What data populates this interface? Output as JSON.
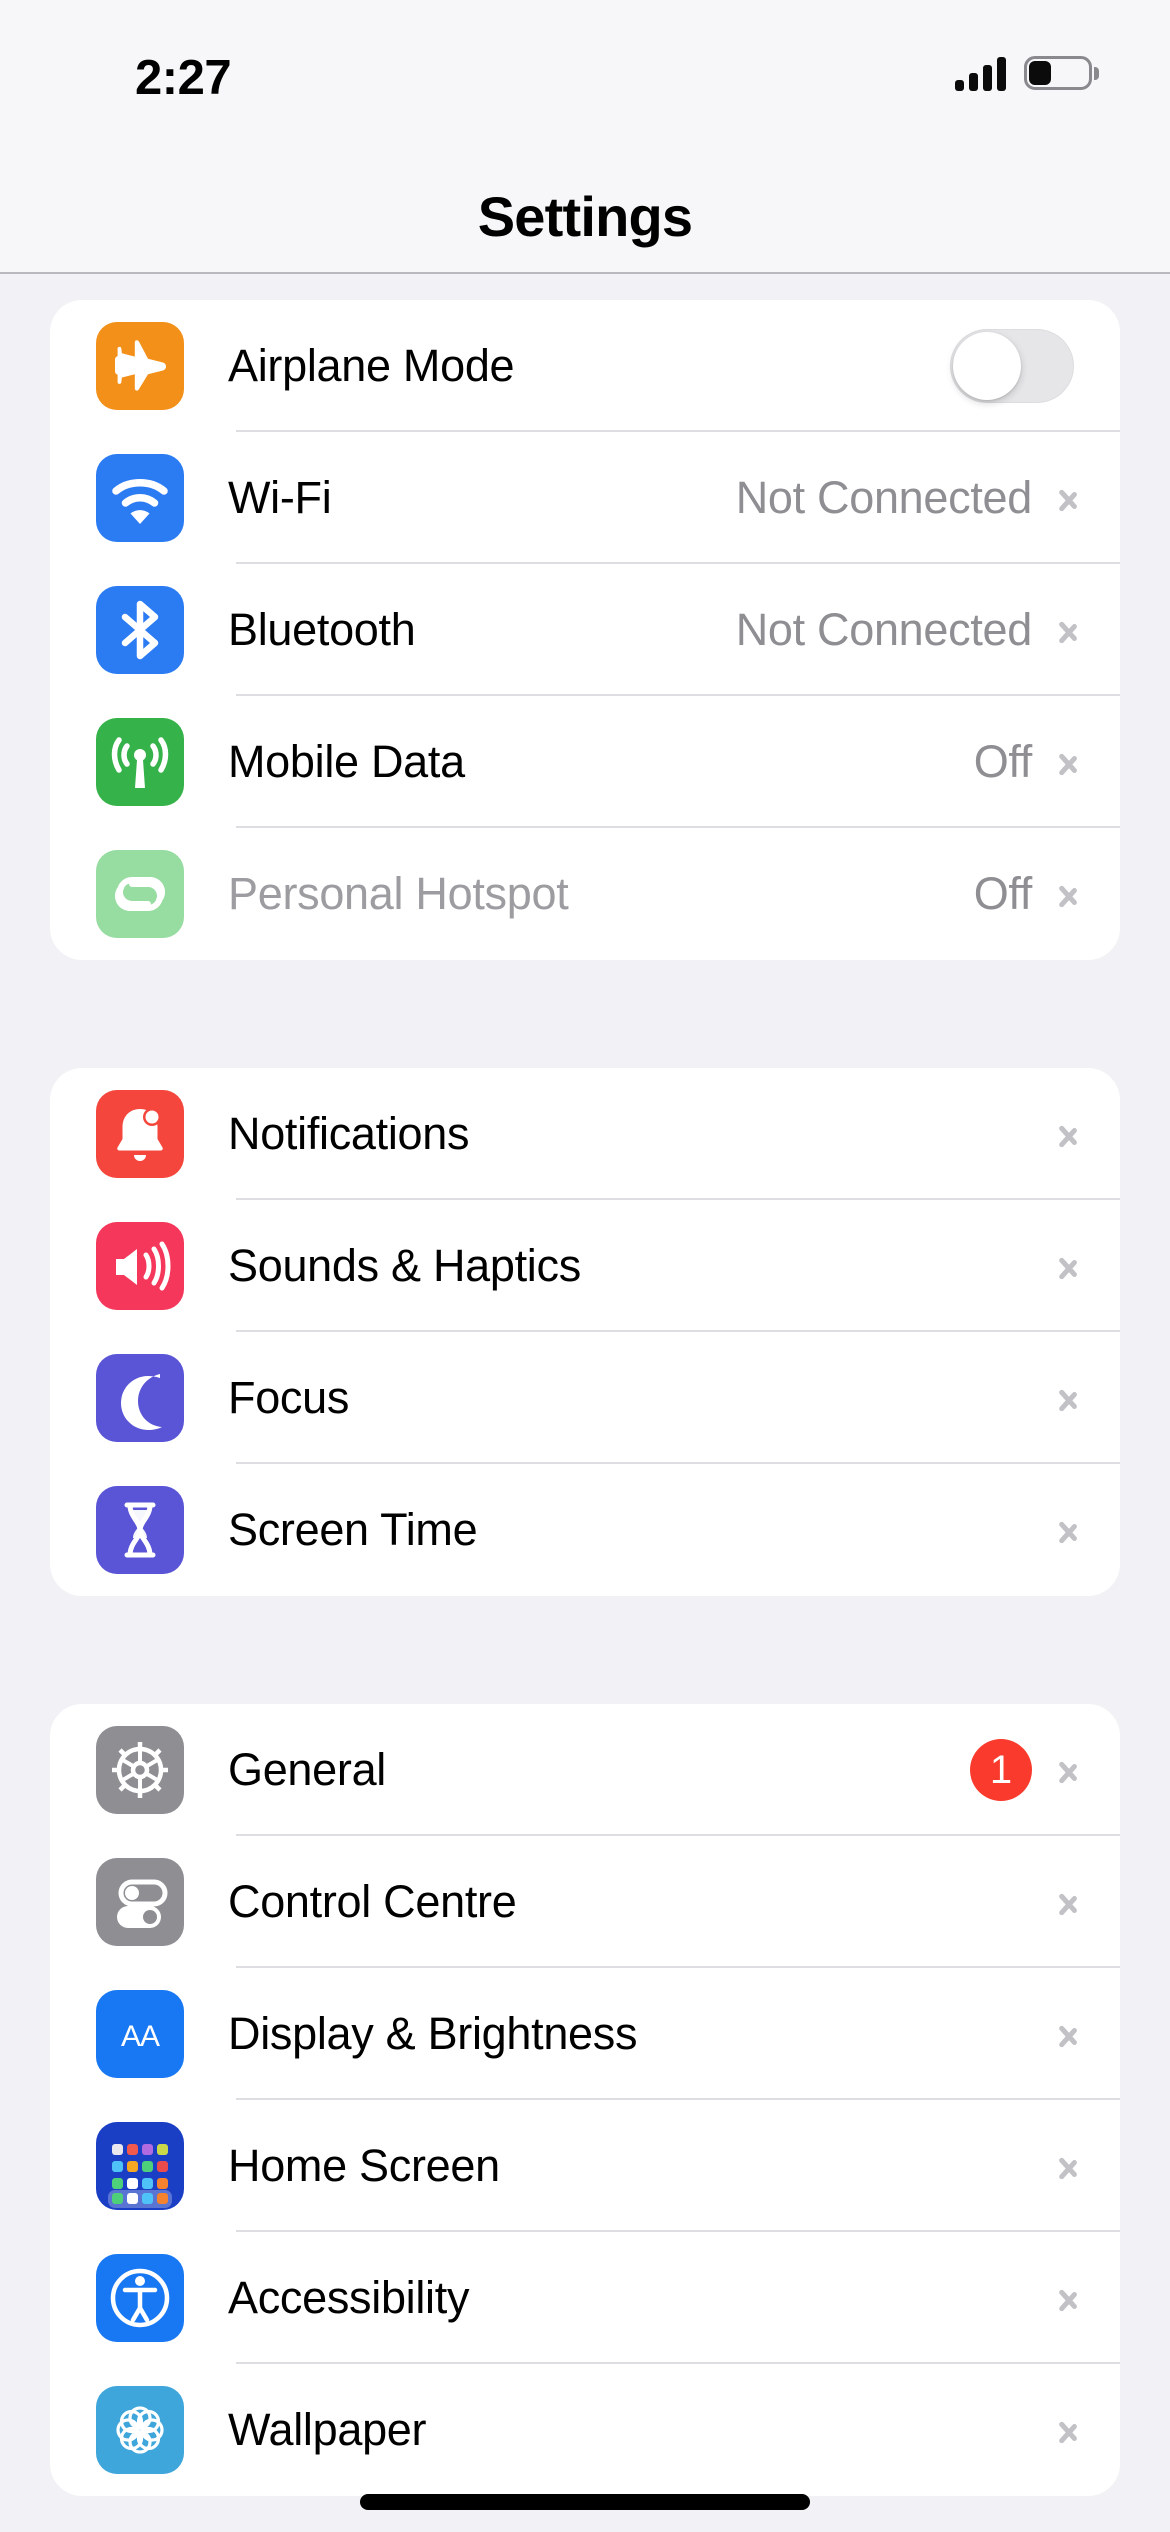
{
  "status_bar": {
    "time": "2:27",
    "signal_icon": "cellular-signal-icon",
    "signal_bars": 4,
    "battery_icon": "battery-icon",
    "battery_level_pct": 35
  },
  "nav": {
    "title": "Settings"
  },
  "groups": [
    {
      "id": "connectivity",
      "rows": [
        {
          "label": "Airplane Mode",
          "icon": "airplane-icon",
          "icon_color": "#F29019",
          "accessory": "toggle",
          "toggle_on": false,
          "value": "",
          "dimmed": false
        },
        {
          "label": "Wi-Fi",
          "icon": "wifi-icon",
          "icon_color": "#2B7BF3",
          "accessory": "chevron",
          "value": "Not Connected",
          "dimmed": false
        },
        {
          "label": "Bluetooth",
          "icon": "bluetooth-icon",
          "icon_color": "#2B7BF3",
          "accessory": "chevron",
          "value": "Not Connected",
          "dimmed": false
        },
        {
          "label": "Mobile Data",
          "icon": "cellular-tower-icon",
          "icon_color": "#36B24A",
          "accessory": "chevron",
          "value": "Off",
          "dimmed": false
        },
        {
          "label": "Personal Hotspot",
          "icon": "hotspot-link-icon",
          "icon_color": "#97DCA0",
          "accessory": "chevron",
          "value": "Off",
          "dimmed": true
        }
      ]
    },
    {
      "id": "alerts",
      "rows": [
        {
          "label": "Notifications",
          "icon": "bell-icon",
          "icon_color": "#F4463C",
          "accessory": "chevron",
          "value": "",
          "dimmed": false
        },
        {
          "label": "Sounds & Haptics",
          "icon": "speaker-icon",
          "icon_color": "#F4375A",
          "accessory": "chevron",
          "value": "",
          "dimmed": false
        },
        {
          "label": "Focus",
          "icon": "moon-icon",
          "icon_color": "#5A54D6",
          "accessory": "chevron",
          "value": "",
          "dimmed": false
        },
        {
          "label": "Screen Time",
          "icon": "hourglass-icon",
          "icon_color": "#5A54D6",
          "accessory": "chevron",
          "value": "",
          "dimmed": false
        }
      ]
    },
    {
      "id": "system",
      "rows": [
        {
          "label": "General",
          "icon": "gear-icon",
          "icon_color": "#8E8E93",
          "accessory": "chevron",
          "value": "",
          "badge": "1",
          "dimmed": false
        },
        {
          "label": "Control Centre",
          "icon": "sliders-icon",
          "icon_color": "#8E8E93",
          "accessory": "chevron",
          "value": "",
          "dimmed": false
        },
        {
          "label": "Display & Brightness",
          "icon": "text-size-icon",
          "icon_color": "#1878F3",
          "accessory": "chevron",
          "value": "",
          "dimmed": false
        },
        {
          "label": "Home Screen",
          "icon": "app-grid-icon",
          "icon_color": "#1B3FC4",
          "accessory": "chevron",
          "value": "",
          "dimmed": false
        },
        {
          "label": "Accessibility",
          "icon": "accessibility-icon",
          "icon_color": "#1878F3",
          "accessory": "chevron",
          "value": "",
          "dimmed": false
        },
        {
          "label": "Wallpaper",
          "icon": "flower-icon",
          "icon_color": "#3FA6DB",
          "accessory": "chevron",
          "value": "",
          "dimmed": false
        }
      ]
    }
  ],
  "badge_color": "#FA3A2C",
  "home_indicator": "home-indicator"
}
